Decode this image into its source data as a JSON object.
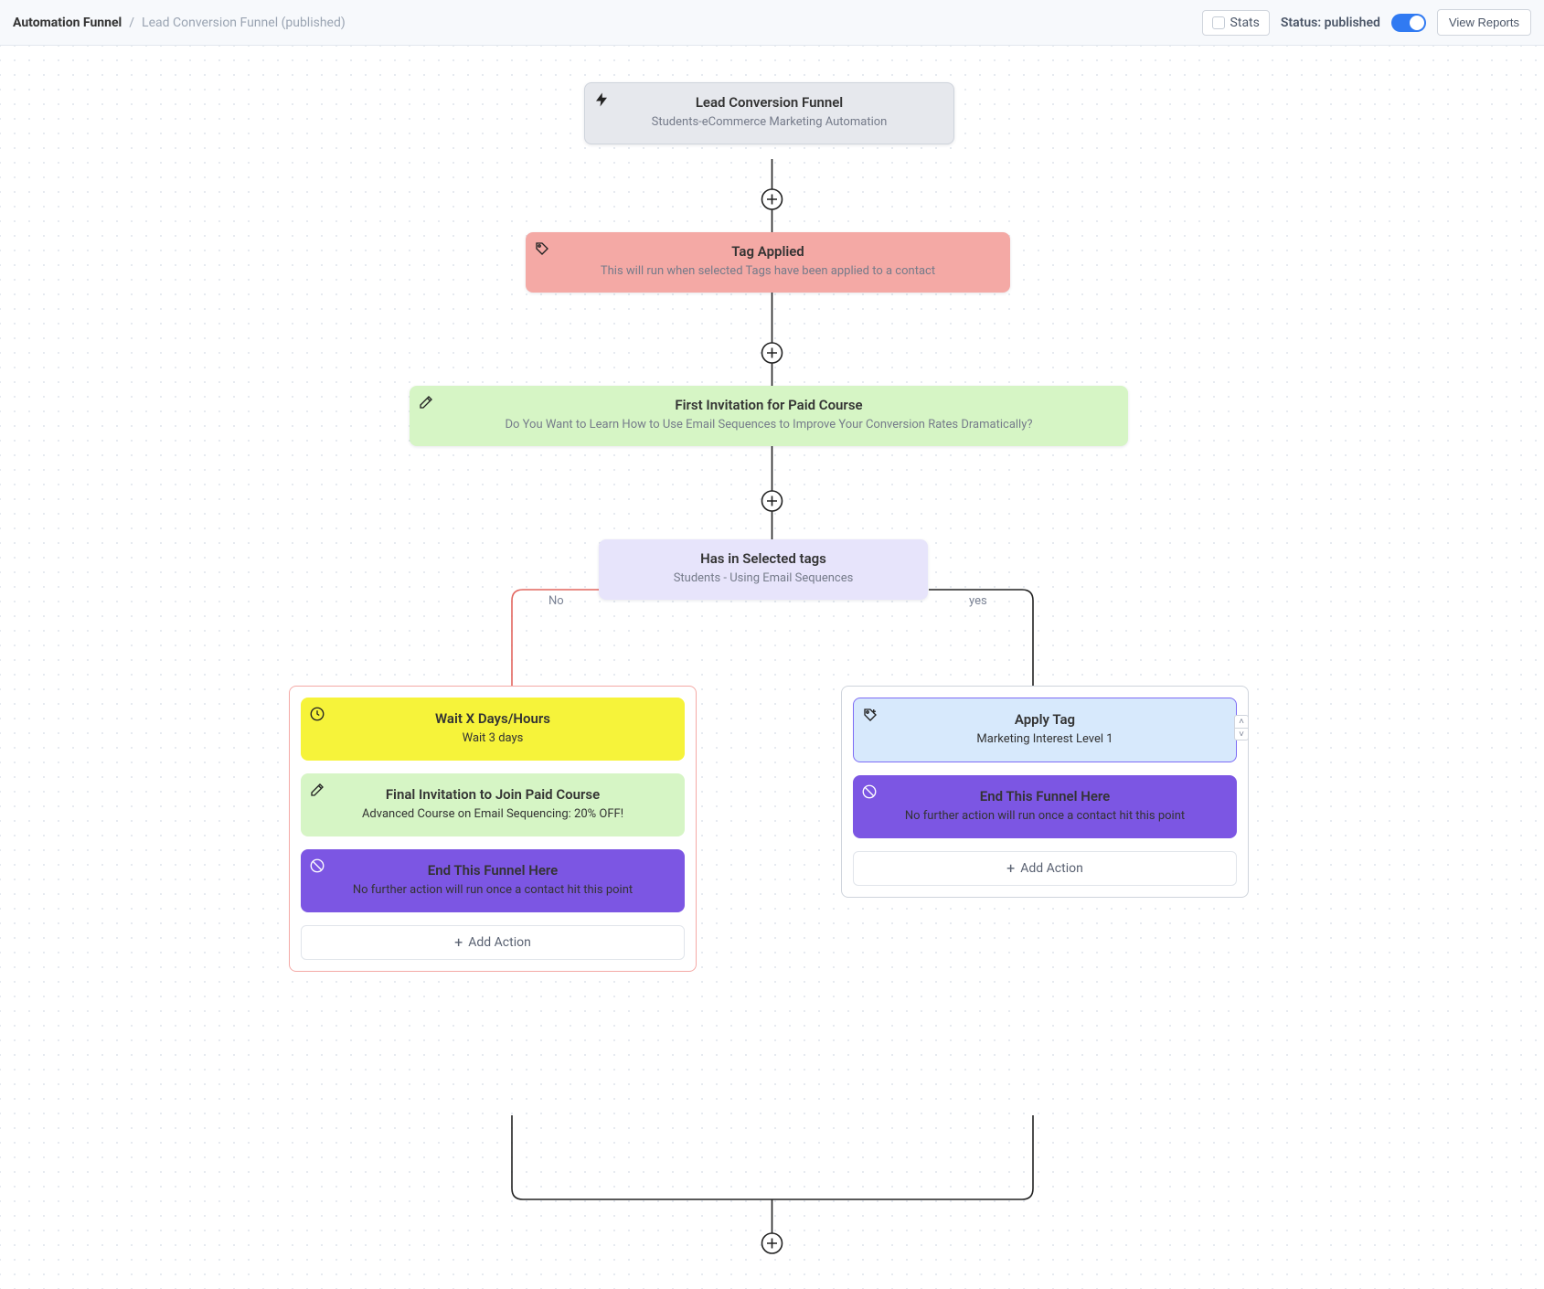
{
  "header": {
    "breadcrumb_root": "Automation Funnel",
    "breadcrumb_sep": "/",
    "breadcrumb_leaf": "Lead Conversion Funnel (published)",
    "stats_label": "Stats",
    "status_label": "Status: published",
    "view_reports": "View Reports"
  },
  "nodes": {
    "start": {
      "title": "Lead Conversion Funnel",
      "subtitle": "Students-eCommerce Marketing Automation"
    },
    "trigger": {
      "title": "Tag Applied",
      "subtitle": "This will run when selected Tags have been applied to a contact"
    },
    "email1": {
      "title": "First Invitation for Paid Course",
      "subtitle": "Do You Want to Learn How to Use Email Sequences to Improve Your Conversion Rates Dramatically?"
    },
    "condition": {
      "title": "Has in Selected tags",
      "subtitle": "Students - Using Email Sequences"
    }
  },
  "branch_labels": {
    "no": "No",
    "yes": "yes"
  },
  "no_branch": {
    "wait": {
      "title": "Wait X Days/Hours",
      "subtitle": "Wait 3 days"
    },
    "email2": {
      "title": "Final Invitation to Join Paid Course",
      "subtitle": "Advanced Course on Email Sequencing: 20% OFF!"
    },
    "end": {
      "title": "End This Funnel Here",
      "subtitle": "No further action will run once a contact hit this point"
    },
    "add_action": "Add Action"
  },
  "yes_branch": {
    "apply_tag": {
      "title": "Apply Tag",
      "subtitle": "Marketing Interest Level 1"
    },
    "end": {
      "title": "End This Funnel Here",
      "subtitle": "No further action will run once a contact hit this point"
    },
    "add_action": "Add Action"
  }
}
